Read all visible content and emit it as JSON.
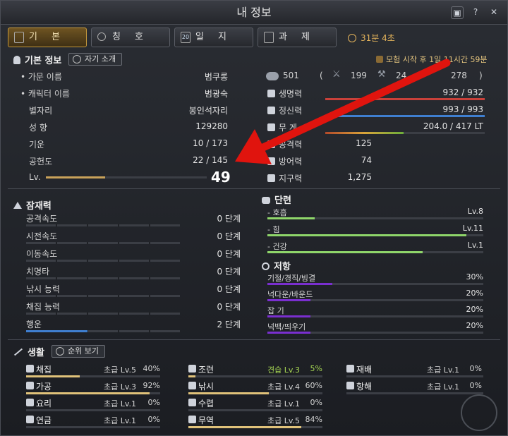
{
  "window": {
    "title": "내 정보"
  },
  "tabs": [
    {
      "label": "기 본",
      "active": true
    },
    {
      "label": "칭 호"
    },
    {
      "label": "일 지",
      "badge": "20"
    },
    {
      "label": "과 제"
    }
  ],
  "timer": "31분 4초",
  "basic": {
    "header": "기본 정보",
    "intro_button": "자기 소개",
    "adventure_start": "모험 시작 후 1일 11시간 59분",
    "rows": [
      {
        "label": "• 가문 이름",
        "value": "범쿠롱"
      },
      {
        "label": "• 캐릭터 이름",
        "value": "범광숙"
      },
      {
        "label": "별자리",
        "value": "봉인석자리"
      },
      {
        "label": "성  향",
        "value": "129280"
      },
      {
        "label": "기운",
        "value": "10 / 173"
      },
      {
        "label": "공헌도",
        "value": "22 / 145"
      },
      {
        "label": "Lv.",
        "value": "49"
      }
    ],
    "level_progress": 0.37
  },
  "stats": {
    "contrib_total": "501",
    "contrib_a": "199",
    "contrib_b": "24",
    "contrib_c": "278",
    "paren_open": "(",
    "paren_close": ")",
    "rows": [
      {
        "label": "생명력",
        "value": "932 / 932",
        "fill": 1.0,
        "color": "#c9413a"
      },
      {
        "label": "정신력",
        "value": "993 / 993",
        "fill": 1.0,
        "color": "#3f7fd0"
      },
      {
        "label": "무 게",
        "value": "204.0 / 417 LT",
        "fill": 0.49,
        "color": "#d9a43a"
      },
      {
        "label": "공격력",
        "value": "125"
      },
      {
        "label": "방어력",
        "value": "74"
      },
      {
        "label": "지구력",
        "value": "1,275"
      }
    ]
  },
  "potential": {
    "header": "잠재력",
    "rows": [
      {
        "label": "공격속도",
        "value": "0 단계",
        "fill": 0
      },
      {
        "label": "시전속도",
        "value": "0 단계",
        "fill": 0
      },
      {
        "label": "이동속도",
        "value": "0 단계",
        "fill": 0
      },
      {
        "label": "치명타",
        "value": "0 단계",
        "fill": 0
      },
      {
        "label": "낚시 능력",
        "value": "0 단계",
        "fill": 0
      },
      {
        "label": "채집 능력",
        "value": "0 단계",
        "fill": 0
      },
      {
        "label": "행운",
        "value": "2 단계",
        "fill": 0.4
      }
    ]
  },
  "training": {
    "header": "단련",
    "rows": [
      {
        "label": "- 호흡",
        "value": "Lv.8",
        "fill": 0.22
      },
      {
        "label": "- 힘",
        "value": "Lv.11",
        "fill": 0.92
      },
      {
        "label": "- 건강",
        "value": "Lv.1",
        "fill": 0.72
      }
    ]
  },
  "resist": {
    "header": "저항",
    "rows": [
      {
        "label": "기절/경직/빙결",
        "value": "30%",
        "fill": 0.3
      },
      {
        "label": "넉다운/바운드",
        "value": "20%",
        "fill": 0.2
      },
      {
        "label": "잡  기",
        "value": "20%",
        "fill": 0.2
      },
      {
        "label": "넉백/띄우기",
        "value": "20%",
        "fill": 0.2
      }
    ]
  },
  "life": {
    "header": "생활",
    "rank_button": "순위 보기",
    "col1": [
      {
        "label": "채집",
        "grade": "초급 Lv.5",
        "pct": "40%",
        "fill": 0.4
      },
      {
        "label": "가공",
        "grade": "초급 Lv.3",
        "pct": "92%",
        "fill": 0.92
      },
      {
        "label": "요리",
        "grade": "초급 Lv.1",
        "pct": "0%",
        "fill": 0
      },
      {
        "label": "연금",
        "grade": "초급 Lv.1",
        "pct": "0%",
        "fill": 0
      }
    ],
    "col2": [
      {
        "label": "조련",
        "grade": "견습 Lv.3",
        "pct": "5%",
        "fill": 0.05,
        "green": true
      },
      {
        "label": "낚시",
        "grade": "초급 Lv.4",
        "pct": "60%",
        "fill": 0.6
      },
      {
        "label": "수렵",
        "grade": "초급 Lv.1",
        "pct": "0%",
        "fill": 0
      },
      {
        "label": "무역",
        "grade": "초급 Lv.5",
        "pct": "84%",
        "fill": 0.84
      }
    ],
    "col3": [
      {
        "label": "재배",
        "grade": "초급 Lv.1",
        "pct": "0%",
        "fill": 0
      },
      {
        "label": "항해",
        "grade": "초급 Lv.1",
        "pct": "0%",
        "fill": 0
      }
    ]
  },
  "annotation": {
    "arrow_color": "#e0140e"
  }
}
